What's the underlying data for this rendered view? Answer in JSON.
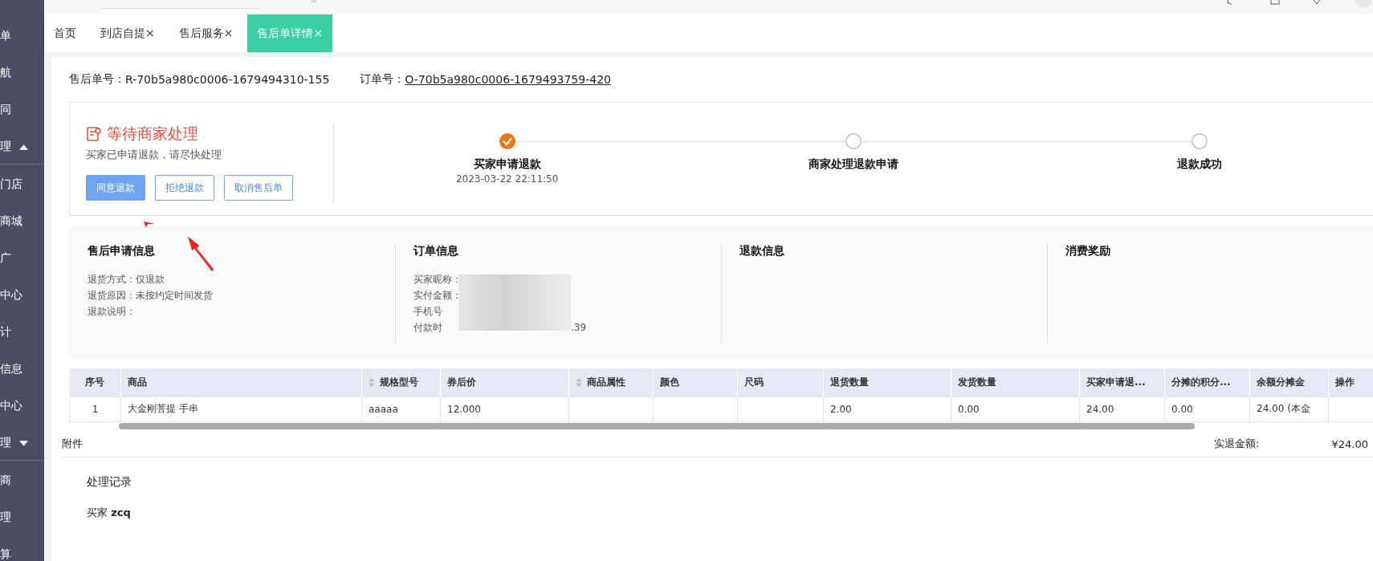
{
  "sidebar": {
    "items": [
      {
        "label": "单",
        "kind": "link"
      },
      {
        "label": "航",
        "kind": "link"
      },
      {
        "label": "同",
        "kind": "link"
      },
      {
        "label": "理",
        "kind": "group",
        "expanded": true
      },
      {
        "label": "门店",
        "kind": "link"
      },
      {
        "label": "商城",
        "kind": "link"
      },
      {
        "label": "广",
        "kind": "link"
      },
      {
        "label": "中心",
        "kind": "link"
      },
      {
        "label": "计",
        "kind": "link"
      },
      {
        "label": "信息",
        "kind": "link"
      },
      {
        "label": "中心",
        "kind": "link"
      },
      {
        "label": "理",
        "kind": "group",
        "expanded": false
      },
      {
        "label": "商",
        "kind": "link"
      },
      {
        "label": "理",
        "kind": "link"
      },
      {
        "label": "算",
        "kind": "link"
      }
    ]
  },
  "tabs": [
    {
      "label": "首页",
      "closable": false,
      "selected": false
    },
    {
      "label": "到店自提",
      "closable": true,
      "selected": false
    },
    {
      "label": "售后服务",
      "closable": true,
      "selected": false
    },
    {
      "label": "售后单详情",
      "closable": true,
      "selected": true
    }
  ],
  "close_glyph": "×",
  "header": {
    "refund_label": "售后单号：",
    "refund_no": "R-70b5a980c0006-1679494310-155",
    "order_label": "订单号：",
    "order_no": "O-70b5a980c0006-1679493759-420"
  },
  "status": {
    "title": "等待商家处理",
    "subtitle": "买家已申请退款，请尽快处理",
    "buttons": [
      {
        "label": "同意退款",
        "kind": "primary"
      },
      {
        "label": "拒绝退款",
        "kind": "outline"
      },
      {
        "label": "取消售后单",
        "kind": "outline"
      }
    ]
  },
  "steps": [
    {
      "label": "买家申请退款",
      "time": "2023-03-22 22:11:50",
      "done": true
    },
    {
      "label": "商家处理退款申请",
      "done": false
    },
    {
      "label": "退款成功",
      "done": false
    }
  ],
  "info_sections": [
    {
      "title": "售后申请信息",
      "lines": [
        "退货方式：仅退款",
        "退货原因：未按约定时间发货",
        "退款说明："
      ],
      "blurred": false
    },
    {
      "title": "订单信息",
      "lines": [
        "买家昵称：",
        "实付金额：",
        "手机号",
        "付款时"
      ],
      "tail": ".39",
      "blurred": true
    },
    {
      "title": "退款信息",
      "blurred": false
    },
    {
      "title": "消费奖励",
      "blurred": false
    }
  ],
  "table": {
    "columns": [
      {
        "label": "序号",
        "sortable": false
      },
      {
        "label": "商品",
        "sortable": false
      },
      {
        "label": "规格型号",
        "sortable": true
      },
      {
        "label": "券后价",
        "sortable": false
      },
      {
        "label": "商品属性",
        "sortable": true
      },
      {
        "label": "颜色",
        "sortable": false
      },
      {
        "label": "尺码",
        "sortable": false
      },
      {
        "label": "退货数量",
        "sortable": false
      },
      {
        "label": "发货数量",
        "sortable": false
      },
      {
        "label": "买家申请退...",
        "sortable": false
      },
      {
        "label": "分摊的积分...",
        "sortable": false
      },
      {
        "label": "余额分摊金",
        "sortable": false
      },
      {
        "label": "操作",
        "sortable": false
      }
    ],
    "rows": [
      [
        "1",
        "大金刚菩提 手串",
        "aaaaa",
        "12.000",
        "",
        "",
        "",
        "2.00",
        "0.00",
        "24.00",
        "0.00",
        "24.00 (本金",
        ""
      ]
    ]
  },
  "attachments_label": "附件",
  "refund_total": {
    "label": "实退金额:",
    "value": "¥24.00"
  },
  "records": {
    "title": "处理记录",
    "role": "买家",
    "user": "zcq"
  }
}
